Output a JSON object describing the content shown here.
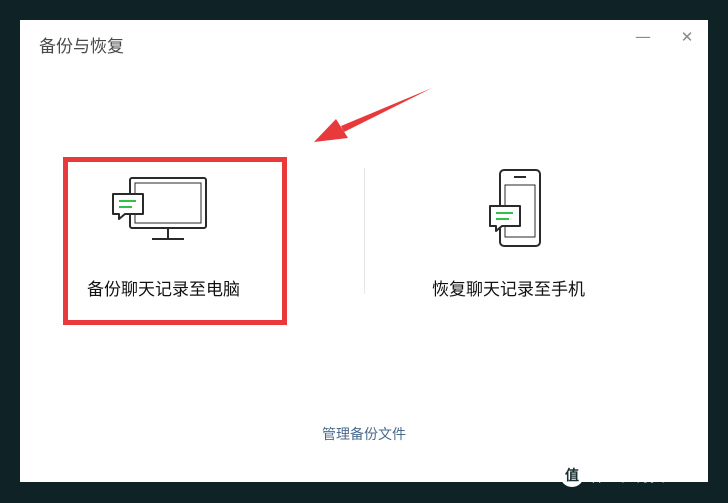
{
  "window": {
    "title": "备份与恢复",
    "minimize_glyph": "—",
    "close_glyph": "✕"
  },
  "options": {
    "backup": {
      "label": "备份聊天记录至电脑",
      "icon": "monitor-chat-icon"
    },
    "restore": {
      "label": "恢复聊天记录至手机",
      "icon": "phone-chat-icon"
    }
  },
  "footer": {
    "manage_label": "管理备份文件"
  },
  "watermark": {
    "text": "什么值得买",
    "logo_glyph": "值"
  },
  "colors": {
    "highlight": "#e8393b",
    "arrow": "#e8393b",
    "chat_green": "#2ec24a",
    "link": "#4a6a8e"
  }
}
